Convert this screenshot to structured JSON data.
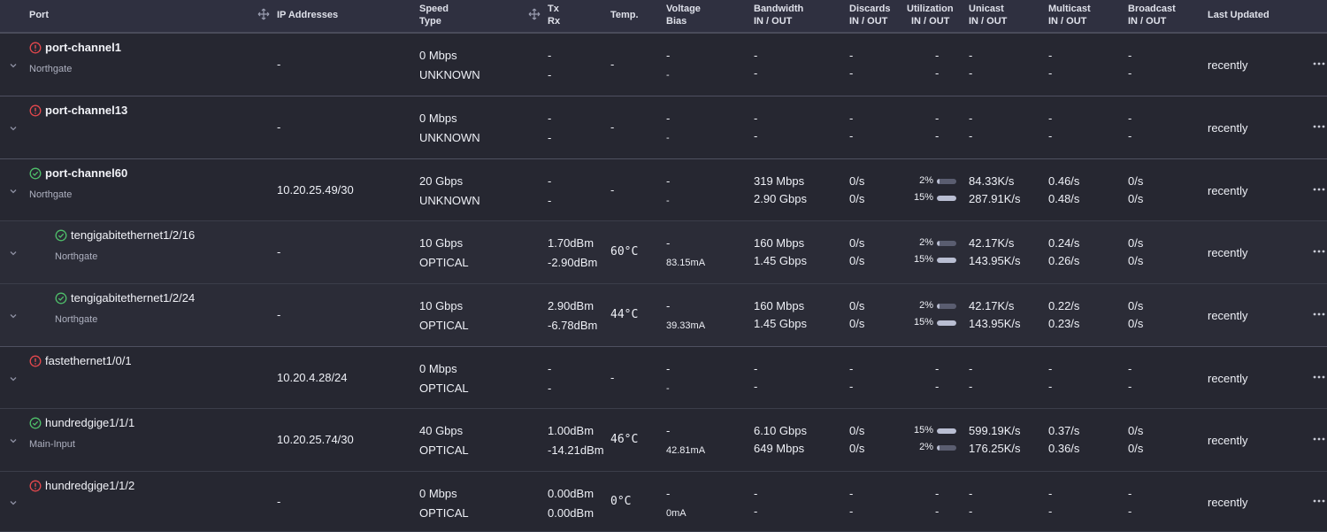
{
  "header": {
    "port": "Port",
    "ip": "IP Addresses",
    "speed": [
      "Speed",
      "Type"
    ],
    "txrx": [
      "Tx",
      "Rx"
    ],
    "temp": "Temp.",
    "voltage": [
      "Voltage",
      "Bias"
    ],
    "bandwidth": [
      "Bandwidth",
      "IN / OUT"
    ],
    "discards": [
      "Discards",
      "IN / OUT"
    ],
    "utilization": [
      "Utilization",
      "IN / OUT"
    ],
    "unicast": [
      "Unicast",
      "IN / OUT"
    ],
    "multicast": [
      "Multicast",
      "IN / OUT"
    ],
    "broadcast": [
      "Broadcast",
      "IN / OUT"
    ],
    "last_updated": "Last Updated"
  },
  "colors": {
    "ok": "#4fbf6a",
    "error": "#e5484d"
  },
  "rows": [
    {
      "status": "error",
      "name": "port-channel1",
      "desc": "Northgate",
      "indent": 0,
      "bold": true,
      "ip": "-",
      "speed": "0 Mbps",
      "type": "UNKNOWN",
      "tx": "-",
      "rx": "-",
      "temp": "-",
      "volt": "-",
      "bias": "-",
      "bw_in": "-",
      "bw_out": "-",
      "disc_in": "-",
      "disc_out": "-",
      "util_in": "-",
      "util_out": "-",
      "uni_in": "-",
      "uni_out": "-",
      "multi_in": "-",
      "multi_out": "-",
      "bcast_in": "-",
      "bcast_out": "-",
      "updated": "recently"
    },
    {
      "status": "error",
      "name": "port-channel13",
      "desc": "",
      "indent": 0,
      "bold": true,
      "ip": "-",
      "speed": "0 Mbps",
      "type": "UNKNOWN",
      "tx": "-",
      "rx": "-",
      "temp": "-",
      "volt": "-",
      "bias": "-",
      "bw_in": "-",
      "bw_out": "-",
      "disc_in": "-",
      "disc_out": "-",
      "util_in": "-",
      "util_out": "-",
      "uni_in": "-",
      "uni_out": "-",
      "multi_in": "-",
      "multi_out": "-",
      "bcast_in": "-",
      "bcast_out": "-",
      "updated": "recently"
    },
    {
      "status": "ok",
      "name": "port-channel60",
      "desc": "Northgate",
      "indent": 0,
      "bold": true,
      "ip": "10.20.25.49/30",
      "speed": "20 Gbps",
      "type": "UNKNOWN",
      "tx": "-",
      "rx": "-",
      "temp": "-",
      "volt": "-",
      "bias": "-",
      "bw_in": "319 Mbps",
      "bw_out": "2.90 Gbps",
      "disc_in": "0/s",
      "disc_out": "0/s",
      "util_in": "2%",
      "util_out": "15%",
      "util_in_val": 2,
      "util_out_val": 15,
      "uni_in": "84.33K/s",
      "uni_out": "287.91K/s",
      "multi_in": "0.46/s",
      "multi_out": "0.48/s",
      "bcast_in": "0/s",
      "bcast_out": "0/s",
      "updated": "recently"
    },
    {
      "status": "ok",
      "name": "tengigabitethernet1/2/16",
      "desc": "Northgate",
      "indent": 1,
      "bold": false,
      "ip": "-",
      "speed": "10 Gbps",
      "type": "OPTICAL",
      "tx": "1.70dBm",
      "rx": "-2.90dBm",
      "temp": "60°C",
      "volt": "-",
      "bias": "83.15mA",
      "bw_in": "160 Mbps",
      "bw_out": "1.45 Gbps",
      "disc_in": "0/s",
      "disc_out": "0/s",
      "util_in": "2%",
      "util_out": "15%",
      "util_in_val": 2,
      "util_out_val": 15,
      "uni_in": "42.17K/s",
      "uni_out": "143.95K/s",
      "multi_in": "0.24/s",
      "multi_out": "0.26/s",
      "bcast_in": "0/s",
      "bcast_out": "0/s",
      "updated": "recently"
    },
    {
      "status": "ok",
      "name": "tengigabitethernet1/2/24",
      "desc": "Northgate",
      "indent": 1,
      "bold": false,
      "ip": "-",
      "speed": "10 Gbps",
      "type": "OPTICAL",
      "tx": "2.90dBm",
      "rx": "-6.78dBm",
      "temp": "44°C",
      "volt": "-",
      "bias": "39.33mA",
      "bw_in": "160 Mbps",
      "bw_out": "1.45 Gbps",
      "disc_in": "0/s",
      "disc_out": "0/s",
      "util_in": "2%",
      "util_out": "15%",
      "util_in_val": 2,
      "util_out_val": 15,
      "uni_in": "42.17K/s",
      "uni_out": "143.95K/s",
      "multi_in": "0.22/s",
      "multi_out": "0.23/s",
      "bcast_in": "0/s",
      "bcast_out": "0/s",
      "updated": "recently"
    },
    {
      "status": "error",
      "name": "fastethernet1/0/1",
      "desc": "",
      "indent": 0,
      "bold": false,
      "ip": "10.20.4.28/24",
      "speed": "0 Mbps",
      "type": "OPTICAL",
      "tx": "-",
      "rx": "-",
      "temp": "-",
      "volt": "-",
      "bias": "-",
      "bw_in": "-",
      "bw_out": "-",
      "disc_in": "-",
      "disc_out": "-",
      "util_in": "-",
      "util_out": "-",
      "uni_in": "-",
      "uni_out": "-",
      "multi_in": "-",
      "multi_out": "-",
      "bcast_in": "-",
      "bcast_out": "-",
      "updated": "recently"
    },
    {
      "status": "ok",
      "name": "hundredgige1/1/1",
      "desc": "Main-Input",
      "indent": 0,
      "bold": false,
      "ip": "10.20.25.74/30",
      "speed": "40 Gbps",
      "type": "OPTICAL",
      "tx": "1.00dBm",
      "rx": "-14.21dBm",
      "temp": "46°C",
      "volt": "-",
      "bias": "42.81mA",
      "bw_in": "6.10 Gbps",
      "bw_out": "649 Mbps",
      "disc_in": "0/s",
      "disc_out": "0/s",
      "util_in": "15%",
      "util_out": "2%",
      "util_in_val": 15,
      "util_out_val": 2,
      "uni_in": "599.19K/s",
      "uni_out": "176.25K/s",
      "multi_in": "0.37/s",
      "multi_out": "0.36/s",
      "bcast_in": "0/s",
      "bcast_out": "0/s",
      "updated": "recently"
    },
    {
      "status": "error",
      "name": "hundredgige1/1/2",
      "desc": "",
      "indent": 0,
      "bold": false,
      "ip": "-",
      "speed": "0 Mbps",
      "type": "OPTICAL",
      "tx": "0.00dBm",
      "rx": "0.00dBm",
      "temp": "0°C",
      "volt": "-",
      "bias": "0mA",
      "bw_in": "-",
      "bw_out": "-",
      "disc_in": "-",
      "disc_out": "-",
      "util_in": "-",
      "util_out": "-",
      "uni_in": "-",
      "uni_out": "-",
      "multi_in": "-",
      "multi_out": "-",
      "bcast_in": "-",
      "bcast_out": "-",
      "updated": "recently"
    }
  ]
}
